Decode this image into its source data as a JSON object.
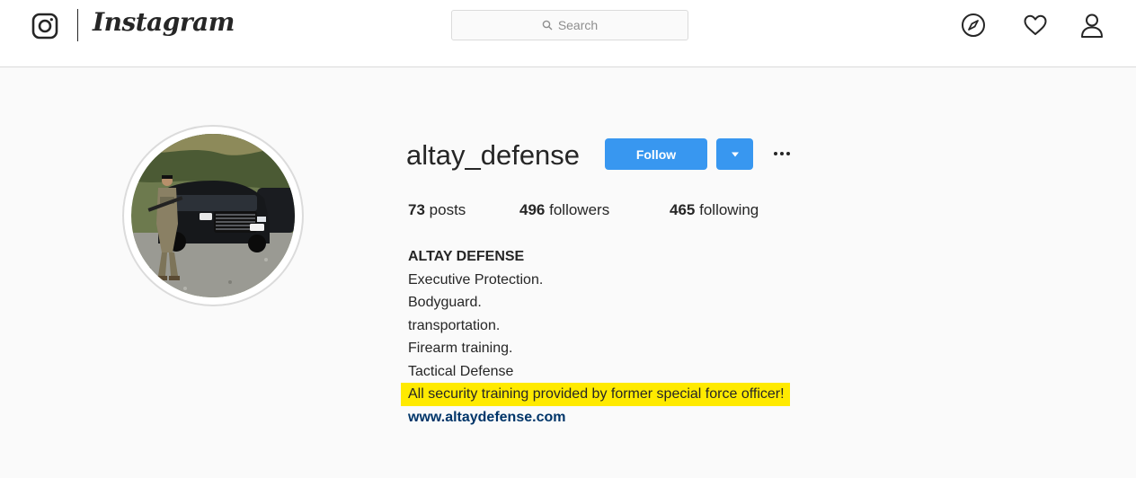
{
  "header": {
    "brand": "Instagram",
    "search_placeholder": "Search"
  },
  "profile": {
    "username": "altay_defense",
    "follow_label": "Follow",
    "more_label": "···",
    "stats": {
      "posts_count": "73",
      "posts_label": "posts",
      "followers_count": "496",
      "followers_label": "followers",
      "following_count": "465",
      "following_label": "following"
    },
    "bio": {
      "name": "ALTAY DEFENSE",
      "lines": [
        "Executive Protection.",
        "Bodyguard.",
        "transportation.",
        "Firearm training.",
        "Tactical Defense"
      ],
      "highlighted_line": "All security training provided by former special force officer!",
      "link": "www.altaydefense.com"
    }
  },
  "colors": {
    "accent": "#3897f0",
    "highlight": "#ffea00",
    "link": "#003569"
  }
}
